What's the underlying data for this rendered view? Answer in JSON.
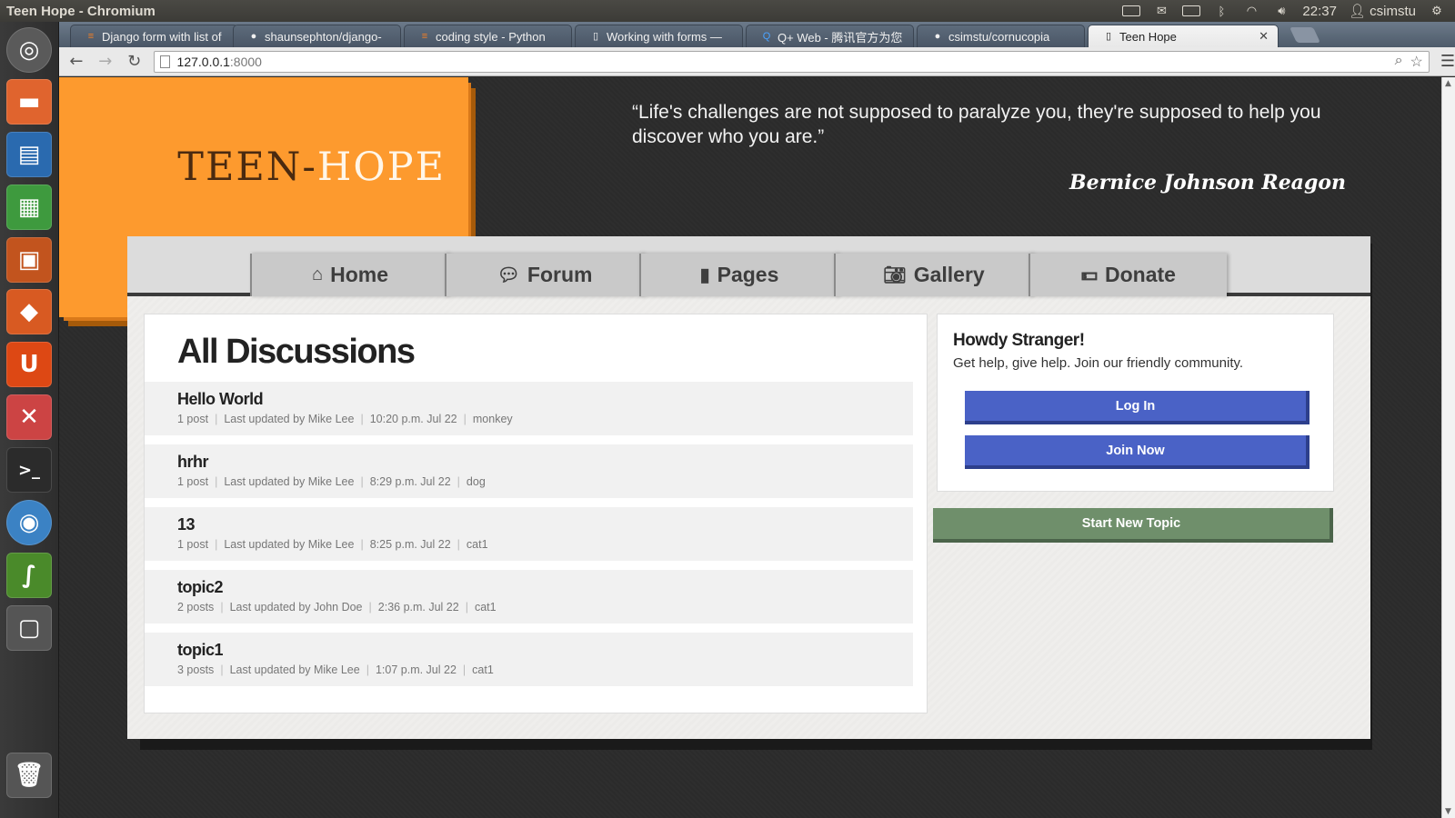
{
  "window_title": "Teen Hope - Chromium",
  "tray": {
    "clock": "22:37",
    "user": "csimstu"
  },
  "tabs": [
    {
      "label": "Django form with list of",
      "fav": "stack"
    },
    {
      "label": "shaunsephton/django-",
      "fav": "github"
    },
    {
      "label": "coding style - Python",
      "fav": "stack"
    },
    {
      "label": "Working with forms —",
      "fav": "doc"
    },
    {
      "label": "Q+ Web - 腾讯官方为您",
      "fav": "qq"
    },
    {
      "label": "csimstu/cornucopia",
      "fav": "github"
    },
    {
      "label": "Teen Hope",
      "fav": "doc",
      "active": true
    }
  ],
  "address": {
    "host": "127.0.0.1",
    "port": ":8000"
  },
  "site": {
    "logo_part1": "TEEN-",
    "logo_part2": "HOPE",
    "quote": "“Life's challenges are not supposed to paralyze you, they're supposed to help you discover who you are.”",
    "quote_author": "Bernice Johnson Reagon",
    "nav": [
      {
        "label": "Home",
        "icon": "home-icon"
      },
      {
        "label": "Forum",
        "icon": "comments-icon"
      },
      {
        "label": "Pages",
        "icon": "file-icon"
      },
      {
        "label": "Gallery",
        "icon": "camera-icon"
      },
      {
        "label": "Donate",
        "icon": "money-icon"
      }
    ],
    "discussions_title": "All Discussions",
    "topics": [
      {
        "name": "Hello World",
        "posts": "1 post",
        "updated": "Last updated by Mike Lee",
        "time": "10:20 p.m. Jul 22",
        "category": "monkey"
      },
      {
        "name": "hrhr",
        "posts": "1 post",
        "updated": "Last updated by Mike Lee",
        "time": "8:29 p.m. Jul 22",
        "category": "dog"
      },
      {
        "name": "13",
        "posts": "1 post",
        "updated": "Last updated by Mike Lee",
        "time": "8:25 p.m. Jul 22",
        "category": "cat1"
      },
      {
        "name": "topic2",
        "posts": "2 posts",
        "updated": "Last updated by John Doe",
        "time": "2:36 p.m. Jul 22",
        "category": "cat1"
      },
      {
        "name": "topic1",
        "posts": "3 posts",
        "updated": "Last updated by Mike Lee",
        "time": "1:07 p.m. Jul 22",
        "category": "cat1"
      }
    ],
    "sidebar": {
      "title": "Howdy Stranger!",
      "subtitle": "Get help, give help. Join our friendly community.",
      "login_label": "Log In",
      "join_label": "Join Now",
      "new_topic_label": "Start New Topic"
    }
  },
  "colors": {
    "logo_orange": "#fd9a2e",
    "button_blue": "#4a62c6",
    "button_green": "#6f8f6b"
  }
}
